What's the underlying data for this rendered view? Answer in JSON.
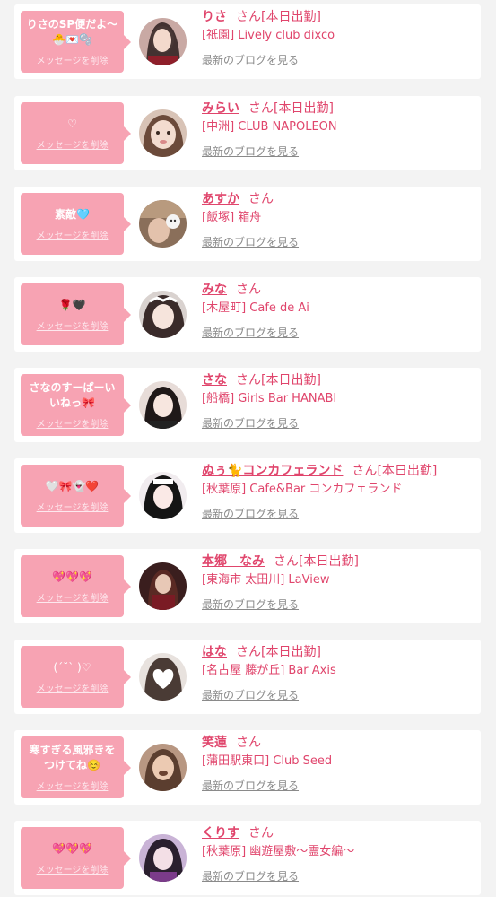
{
  "colors": {
    "accent": "#e0456c",
    "bubble": "#f7a3b3",
    "background": "#f3f3f3"
  },
  "delete_label": "メッセージを削除",
  "blog_label": "最新のブログを見る",
  "entries": [
    {
      "message": "りさのSP便だよ〜🐣💌🫧",
      "name": "りさ",
      "suffix": "さん",
      "status": "[本日出勤]",
      "shop": "[祇園] Lively club dixco"
    },
    {
      "message": "♡",
      "name": "みらい",
      "suffix": "さん",
      "status": "[本日出勤]",
      "shop": "[中洲] CLUB NAPOLEON"
    },
    {
      "message": "素敵🩵",
      "name": "あすか",
      "suffix": "さん",
      "status": "",
      "shop": "[飯塚] 箱舟"
    },
    {
      "message": "🌹🖤",
      "name": "みな",
      "suffix": "さん",
      "status": "",
      "shop": "[木屋町] Cafe de Ai"
    },
    {
      "message": "さなのすーぱーいいねっ🎀",
      "name": "さな",
      "suffix": "さん",
      "status": "[本日出勤]",
      "shop": "[船橋] Girls Bar HANABI"
    },
    {
      "message": "🤍🎀👻❤️",
      "name": "ぬぅ🐈コンカフェランド",
      "suffix": "さん",
      "status": "[本日出勤]",
      "shop": "[秋葉原] Cafe&Bar コンカフェランド"
    },
    {
      "message": "💖💖💖",
      "name": "本郷　なみ",
      "suffix": "さん",
      "status": "[本日出勤]",
      "shop": "[東海市 太田川] LaView"
    },
    {
      "message": "(ˊ˘ˋ )♡",
      "name": "はな",
      "suffix": "さん",
      "status": "[本日出勤]",
      "shop": "[名古屋 藤が丘] Bar Axis"
    },
    {
      "message": "寒すぎる風邪きをつけてね☺️",
      "name": "笑蓮",
      "suffix": "さん",
      "status": "",
      "shop": "[蒲田駅東口] Club Seed"
    },
    {
      "message": "💖💖💖",
      "name": "くりす",
      "suffix": "さん",
      "status": "",
      "shop": "[秋葉原] 幽遊屋敷〜霊女編〜"
    }
  ]
}
